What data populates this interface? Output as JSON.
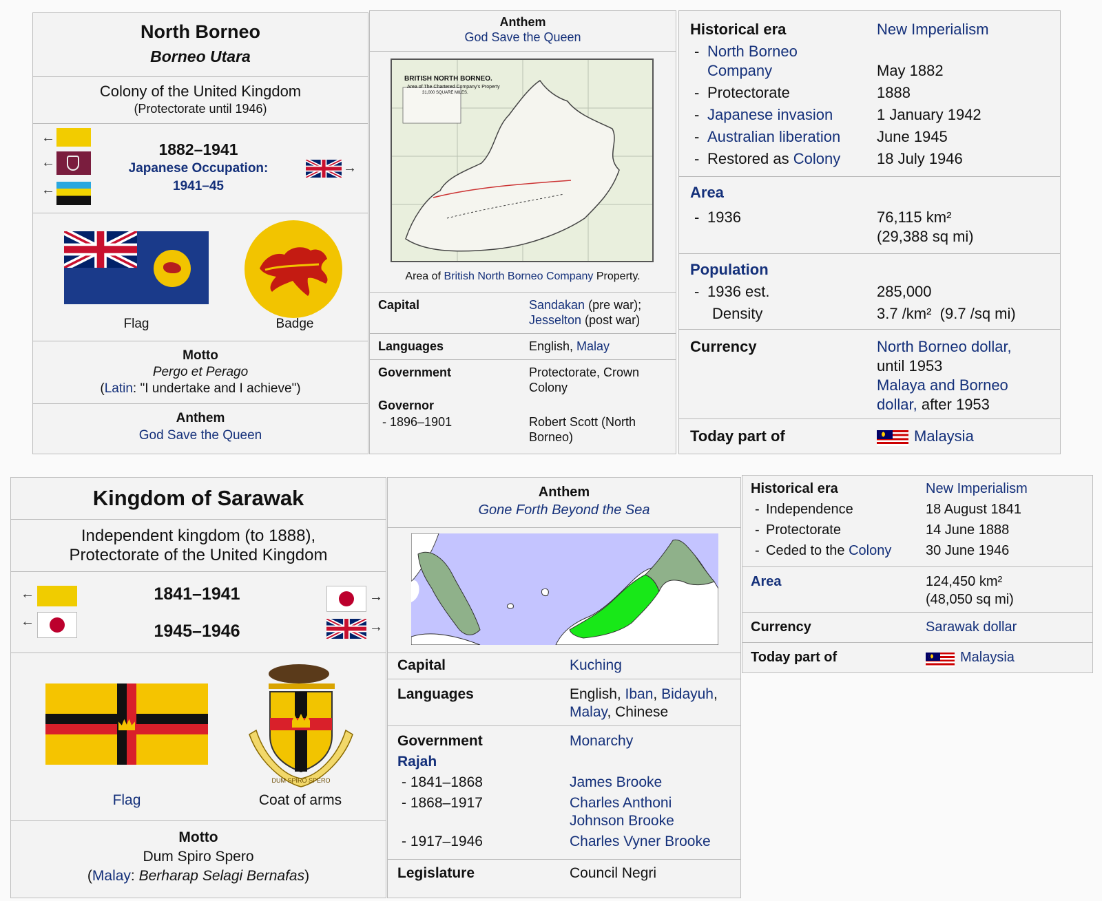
{
  "north_borneo": {
    "left": {
      "name": "North Borneo",
      "local_name": "Borneo Utara",
      "status": "Colony of the United Kingdom",
      "status_note": "(Protectorate until 1946)",
      "years": "1882–1941",
      "occupation_label": "Japanese Occupation:",
      "occupation_years": "1941–45",
      "arrow_left": "←",
      "arrow_right": "→",
      "flag_caption": "Flag",
      "badge_caption": "Badge",
      "motto_title": "Motto",
      "motto": "Pergo et Perago",
      "motto_lang": "Latin",
      "motto_translation": ": \"I undertake and I achieve\")",
      "motto_open": "(",
      "anthem_title": "Anthem",
      "anthem": "God Save the Queen"
    },
    "middle": {
      "anthem_title": "Anthem",
      "anthem": "God Save the Queen",
      "map_title": "BRITISH NORTH BORNEO.",
      "map_subtitle": "Area of The Chartered Company's Property",
      "map_subtitle2": "31,000 SQUARE MILES.",
      "map_caption_pre": "Area of ",
      "map_caption_link": "British North Borneo Company",
      "map_caption_post": " Property.",
      "capital_label": "Capital",
      "capital_1_link": "Sandakan",
      "capital_1_note": " (pre war);",
      "capital_2_link": "Jesselton",
      "capital_2_note": " (post war)",
      "languages_label": "Languages",
      "languages_1": "English, ",
      "languages_2_link": "Malay",
      "government_label": "Government",
      "government_value_1": "Protectorate, Crown",
      "government_value_2": "Colony",
      "governor_label": "Governor",
      "governor_period": "- 1896–1901",
      "governor_name_1": "Robert Scott (North",
      "governor_name_2": "Borneo)"
    },
    "right": {
      "era_label": "Historical era",
      "era_value": "New Imperialism",
      "events": [
        {
          "label_1": "North Borneo",
          "label_2": "Company",
          "date": "May 1882"
        },
        {
          "label": "Protectorate",
          "date": "1888"
        },
        {
          "label": "Japanese invasion",
          "date": "1 January 1942"
        },
        {
          "label": "Australian liberation",
          "date": "June 1945"
        },
        {
          "label_pre": "Restored as ",
          "label_link": "Colony",
          "date": "18 July 1946"
        }
      ],
      "area_label": "Area",
      "area_year": "1936",
      "area_value_1": "76,115 km²",
      "area_value_2": "(29,388 sq mi)",
      "population_label": "Population",
      "population_year": "1936 est.",
      "population_value": "285,000",
      "density_label": "Density",
      "density_value": "3.7 /km²  (9.7 /sq mi)",
      "currency_label": "Currency",
      "currency_1_link": "North Borneo dollar,",
      "currency_1_note": "until 1953",
      "currency_2_link": "Malaya and Borneo",
      "currency_2_link_b": "dollar,",
      "currency_2_note": " after 1953",
      "today_label": "Today part of",
      "today_value": "Malaysia",
      "dash": "-"
    }
  },
  "sarawak": {
    "left": {
      "name": "Kingdom of Sarawak",
      "status_1": "Independent kingdom (to 1888),",
      "status_2": "Protectorate of the United Kingdom",
      "years_1": "1841–1941",
      "years_2": "1945–1946",
      "arrow_left": "←",
      "arrow_right": "→",
      "flag_caption": "Flag",
      "coat_caption": "Coat of arms",
      "coat_motto": "DUM SPIRO SPERO",
      "motto_title": "Motto",
      "motto": "Dum Spiro Spero",
      "motto_open": "(",
      "motto_lang": "Malay",
      "motto_colon": ": ",
      "motto_translation": "Berharap Selagi Bernafas",
      "motto_close": ")"
    },
    "middle": {
      "anthem_title": "Anthem",
      "anthem": "Gone Forth Beyond the Sea",
      "capital_label": "Capital",
      "capital": "Kuching",
      "languages_label": "Languages",
      "languages_1": "English, ",
      "languages_2_link": "Iban",
      "languages_comma": ", ",
      "languages_3_link": "Bidayuh",
      "languages_comma2": ",",
      "languages_4_link": "Malay",
      "languages_5": ", Chinese",
      "government_label": "Government",
      "government_value": "Monarchy",
      "rajah_label": "Rajah",
      "rajahs": [
        {
          "period": "- 1841–1868",
          "name_1": "James Brooke"
        },
        {
          "period": "- 1868–1917",
          "name_1": "Charles Anthoni",
          "name_2": "Johnson Brooke"
        },
        {
          "period": "- 1917–1946",
          "name_1": "Charles Vyner Brooke"
        }
      ],
      "legislature_label": "Legislature",
      "legislature_value": "Council Negri"
    },
    "right": {
      "era_label": "Historical era",
      "era_value": "New Imperialism",
      "events": [
        {
          "label": "Independence",
          "date": "18 August 1841"
        },
        {
          "label": "Protectorate",
          "date": "14 June 1888"
        },
        {
          "label_pre": "Ceded to the ",
          "label_link": "Colony",
          "date": "30 June 1946"
        }
      ],
      "area_label": "Area",
      "area_value_1": "124,450 km²",
      "area_value_2": "(48,050 sq mi)",
      "currency_label": "Currency",
      "currency_value": "Sarawak dollar",
      "today_label": "Today part of",
      "today_value": "Malaysia",
      "dash": "-"
    }
  },
  "colors": {
    "link": "#14307a",
    "panel_bg": "#f3f3f3",
    "nb_yellow": "#f2c700",
    "nb_blue": "#1a3a8a",
    "sarawak_yellow": "#f5c400",
    "sarawak_red": "#d9202a",
    "map_sea": "#c4c4ff",
    "map_green": "#8fb18a",
    "map_bright": "#18e818"
  }
}
